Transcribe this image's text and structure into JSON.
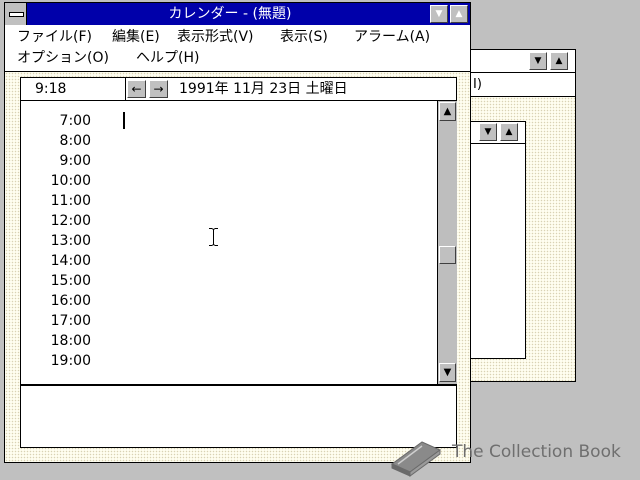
{
  "window": {
    "title": "カレンダー - (無題)",
    "minimize_glyph": "▼",
    "maximize_glyph": "▲"
  },
  "menu": [
    {
      "label": "ファイル(F)"
    },
    {
      "label": "編集(E)"
    },
    {
      "label": "表示形式(V)"
    },
    {
      "label": "表示(S)"
    },
    {
      "label": "アラーム(A)"
    },
    {
      "label": "オプション(O)"
    },
    {
      "label": "ヘルプ(H)"
    }
  ],
  "background_window": {
    "menu_fragment": "I)",
    "minimize_glyph": "▼",
    "maximize_glyph": "▲"
  },
  "infobar": {
    "current_time": "9:18",
    "prev_glyph": "←",
    "next_glyph": "→",
    "date": "1991年 11月 23日 土曜日"
  },
  "schedule": {
    "times": [
      "7:00",
      "8:00",
      "9:00",
      "10:00",
      "11:00",
      "12:00",
      "13:00",
      "14:00",
      "15:00",
      "16:00",
      "17:00",
      "18:00",
      "19:00"
    ]
  },
  "scrollbar": {
    "up_glyph": "▲",
    "down_glyph": "▼",
    "position": 0.55
  },
  "watermark": {
    "text": "The Collection Book",
    "icon": "book-icon"
  },
  "colors": {
    "titlebar_active": "#0000aa",
    "desktop": "#c0c0c0",
    "client_bg": "#fffef0"
  }
}
